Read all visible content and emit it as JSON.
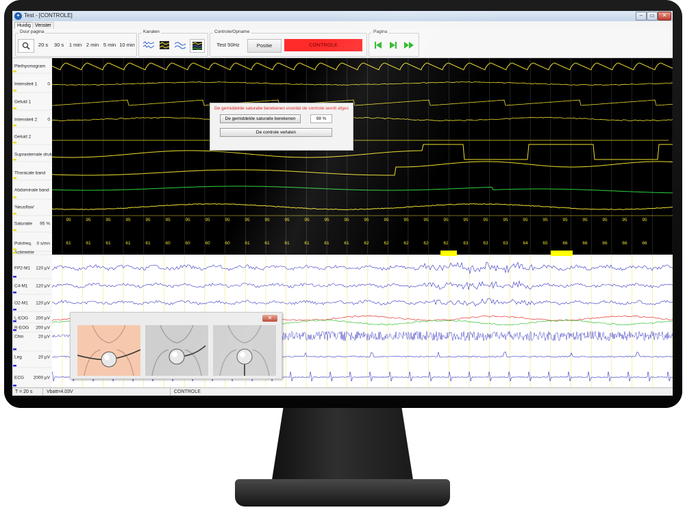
{
  "window": {
    "title": "Test - [CONTROLE]",
    "controls": [
      "–",
      "▭",
      "✕"
    ]
  },
  "menu": [
    "Huidig",
    "Venster"
  ],
  "toolbar": {
    "duration": {
      "label": "Duur pagina",
      "zoom_icon": "magnifier-icon",
      "options": [
        "20 s",
        "30 s",
        "1 min",
        "2 min",
        "5 min",
        "10 min"
      ]
    },
    "channels": {
      "label": "Kanalen",
      "icons": [
        "eeg-channels-icon",
        "grid-channels-icon",
        "respiratory-channels-icon",
        "all-channels-icon"
      ]
    },
    "control": {
      "label": "Controle/Opname",
      "test_label": "Test 50Hz",
      "position_label": "Positie",
      "status_label": "CONTROLE",
      "status_color": "#ff2a2a"
    },
    "page": {
      "label": "Pagina",
      "icons": [
        "skip-first-icon",
        "skip-next-icon",
        "fast-forward-icon"
      ]
    }
  },
  "channels": [
    {
      "name": "Plethysmogram",
      "unit": "",
      "color": "#f0e030"
    },
    {
      "name": "Intensiteit 1",
      "unit": "0",
      "color": "#f0e030"
    },
    {
      "name": "Geluid 1",
      "unit": "",
      "color": "#f0e030"
    },
    {
      "name": "Intensiteit 2",
      "unit": "0",
      "color": "#f0e030"
    },
    {
      "name": "Geluid 2",
      "unit": "",
      "color": "#f0e030"
    },
    {
      "name": "Suprasternale druk",
      "unit": "",
      "color": "#f0e030"
    },
    {
      "name": "Thoracale band",
      "unit": "",
      "color": "#f0e030"
    },
    {
      "name": "Abdominale band",
      "unit": "",
      "color": "#30d040"
    },
    {
      "name": "'Neusflow'",
      "unit": "",
      "color": "#f0e030"
    },
    {
      "name": "Saturatie",
      "unit": "95 %",
      "color": "#f0e030"
    },
    {
      "name": "Polsfreq.",
      "unit": "0 s/mn",
      "color": "#f0e030"
    },
    {
      "name": "Actimetrie",
      "unit": "",
      "color": "#f0e030"
    },
    {
      "name": "FP2-M1",
      "unit": "120 µV",
      "color": "#3030c0"
    },
    {
      "name": "C4-M1",
      "unit": "120 µV",
      "color": "#3030c0"
    },
    {
      "name": "O2-M1",
      "unit": "120 µV",
      "color": "#3030c0"
    },
    {
      "name": "L-EOG",
      "unit": "200 µV",
      "color": "#e03030"
    },
    {
      "name": "R-EOG",
      "unit": "200 µV",
      "color": "#30c030"
    },
    {
      "name": "Chin",
      "unit": "20 µV",
      "color": "#3030c0"
    },
    {
      "name": "Leg",
      "unit": "20 µV",
      "color": "#3030c0"
    },
    {
      "name": "ECG",
      "unit": "2000 µV",
      "color": "#3030c0"
    }
  ],
  "saturation_values": [
    "95",
    "95",
    "95",
    "95",
    "95",
    "95",
    "95",
    "95",
    "95",
    "95",
    "95",
    "95",
    "95",
    "95",
    "95",
    "95",
    "95",
    "95",
    "95",
    "95",
    "95",
    "95",
    "95",
    "95",
    "95",
    "95",
    "95",
    "95",
    "95",
    "95"
  ],
  "pulse_values": [
    "61",
    "61",
    "61",
    "61",
    "61",
    "60",
    "60",
    "60",
    "60",
    "61",
    "61",
    "61",
    "61",
    "61",
    "61",
    "62",
    "62",
    "62",
    "62",
    "62",
    "63",
    "63",
    "63",
    "64",
    "65",
    "66",
    "66",
    "66",
    "66",
    "66"
  ],
  "dialog": {
    "warning": "De gemiddelde saturatie berekenen voordat de controle wordt afges",
    "compute_label": "De gemiddelde saturatie berekenen",
    "value": "98 %",
    "leave_label": "De controle verlaten"
  },
  "sensor_popup": {
    "close_label": "✕",
    "images": [
      "sensor-placement-skin-icon",
      "sensor-placement-grey-icon",
      "sensor-placement-tube-icon"
    ]
  },
  "status": {
    "time": "T = 20 s",
    "battery": "Vbatt=4.03V",
    "mode": "CONTROLE"
  }
}
